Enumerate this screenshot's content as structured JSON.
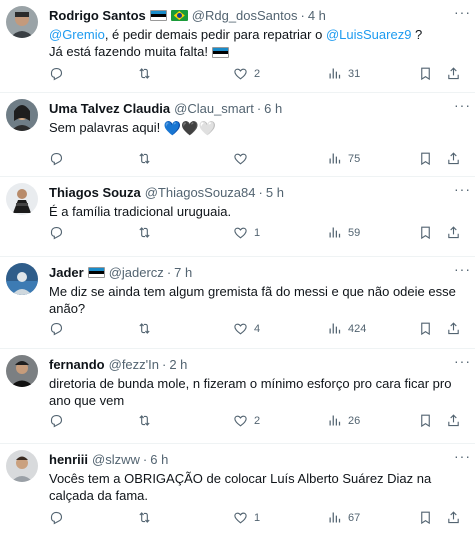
{
  "tweets": [
    {
      "name": "Rodrigo Santos",
      "handle": "@Rdg_dosSantos",
      "time": "4 h",
      "text_parts": [
        {
          "t": "@Gremio",
          "mention": true
        },
        {
          "t": ", é pedir demais pedir para repatriar o ",
          "mention": false
        },
        {
          "t": "@LuisSuarez9",
          "mention": true
        },
        {
          "t": " ?\nJá está fazendo muita falta! ",
          "mention": false
        }
      ],
      "replies": "",
      "retweets": "",
      "likes": "2",
      "views": "31"
    },
    {
      "name": "Uma Talvez Claudia",
      "handle": "@Clau_smart",
      "time": "6 h",
      "text": "Sem palavras aqui! ",
      "emoji": [
        "💙",
        "🖤",
        "🤍"
      ],
      "replies": "",
      "retweets": "",
      "likes": "",
      "views": "75"
    },
    {
      "name": "Thiagos Souza",
      "handle": "@ThiagosSouza84",
      "time": "5 h",
      "text": "É a família tradicional uruguaia.",
      "replies": "",
      "retweets": "",
      "likes": "1",
      "views": "59"
    },
    {
      "name": "Jader",
      "handle": "@jadercz",
      "time": "7 h",
      "text": "Me diz se ainda tem algum gremista fã do messi e que não odeie esse anão?",
      "replies": "",
      "retweets": "",
      "likes": "4",
      "views": "424"
    },
    {
      "name": "fernando",
      "handle": "@fezz'In",
      "time": "2 h",
      "text": "diretoria de bunda mole, n fizeram o mínimo esforço pro cara ficar pro ano que vem",
      "replies": "",
      "retweets": "",
      "likes": "2",
      "views": "26"
    },
    {
      "name": "henriii",
      "handle": "@slzww",
      "time": "6 h",
      "text": "Vocês tem a OBRIGAÇÃO de colocar Luís Alberto Suárez Diaz na calçada da fama.",
      "replies": "",
      "retweets": "",
      "likes": "1",
      "views": "67"
    }
  ],
  "dot": "·",
  "more": "···",
  "colors": {
    "text": "#0f1419",
    "muted": "#536471",
    "link": "#1d9bf0",
    "border": "#eff3f4"
  },
  "icons": [
    "reply-icon",
    "retweet-icon",
    "like-icon",
    "views-icon",
    "bookmark-icon",
    "share-icon"
  ]
}
